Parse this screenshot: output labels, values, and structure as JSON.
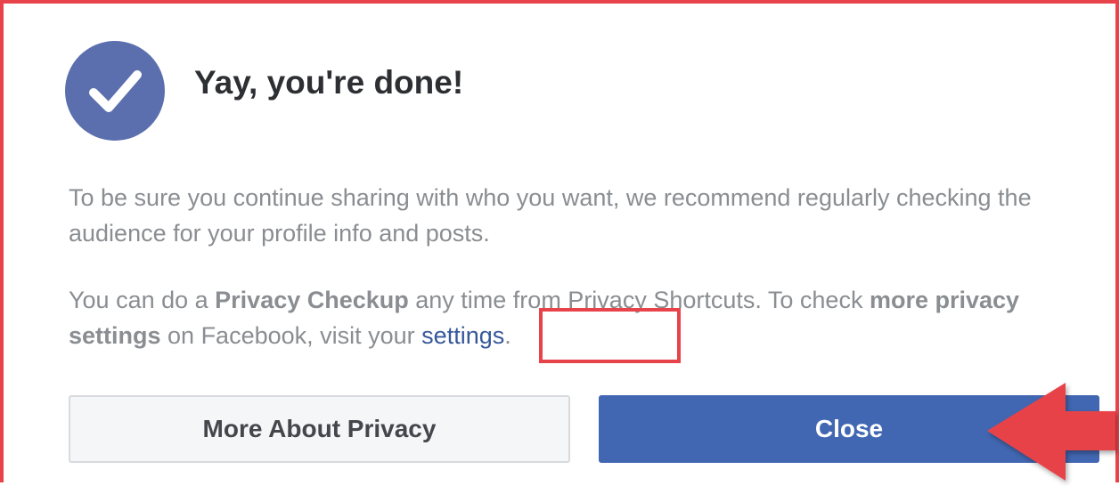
{
  "dialog": {
    "title": "Yay, you're done!",
    "paragraph_1": "To be sure you continue sharing with who you want, we recommend regularly checking the audience for your profile info and posts.",
    "paragraph_2": {
      "part_1": "You can do a ",
      "bold_1": "Privacy Checkup",
      "part_2": " any time from Privacy Shortcuts. To check ",
      "bold_2": "more privacy settings",
      "part_3": " on Facebook, visit your ",
      "link": "settings",
      "part_4": "."
    },
    "buttons": {
      "secondary_label": "More About Privacy",
      "primary_label": "Close"
    }
  },
  "icons": {
    "status": "check-icon",
    "annotation_arrow": "arrow-left-icon"
  },
  "colors": {
    "primary": "#4267b2",
    "badge": "#5b6fae",
    "link": "#365899",
    "annotation": "#e8434a"
  }
}
